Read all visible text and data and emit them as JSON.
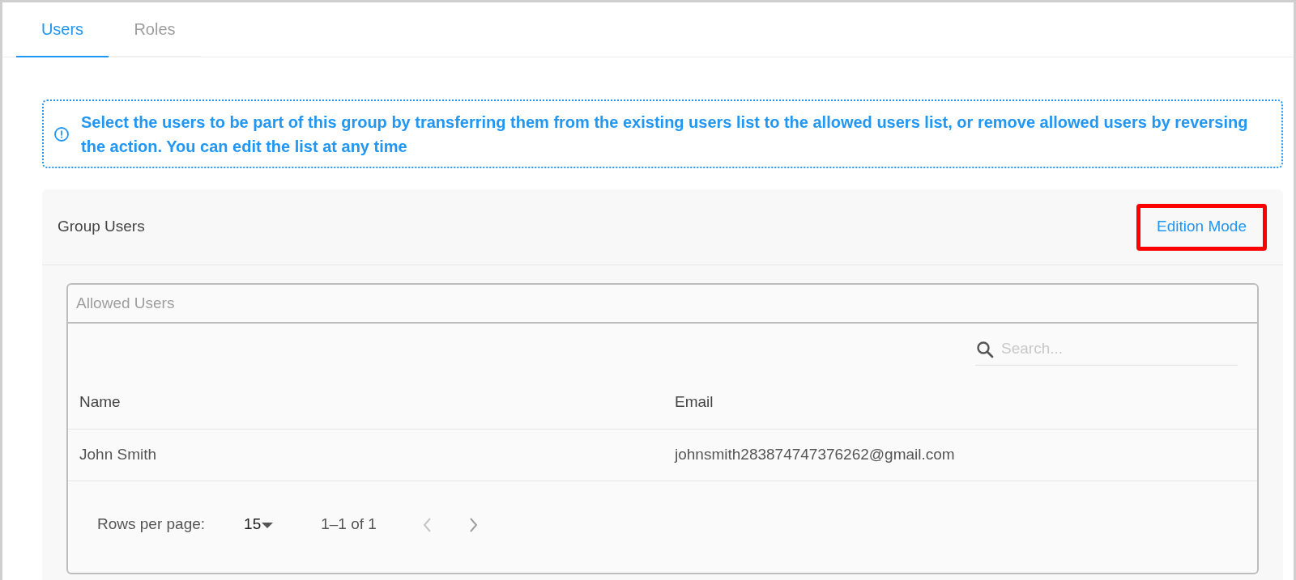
{
  "tabs": [
    {
      "label": "Users",
      "selected": true
    },
    {
      "label": "Roles",
      "selected": false
    }
  ],
  "info_message": "Select the users to be part of this group by transferring them from the existing users list to the allowed users list, or remove allowed users by reversing the action. You can edit the list at any time",
  "group_panel": {
    "title": "Group Users",
    "action": {
      "label": "Edition Mode",
      "highlighted": true
    },
    "table": {
      "title": "Allowed Users",
      "search": {
        "placeholder": "Search..."
      },
      "columns": [
        "Name",
        "Email"
      ],
      "rows": [
        [
          "John Smith",
          "johnsmith283874747376262@gmail.com"
        ]
      ],
      "pagination": {
        "label": "Rows per page:",
        "rows_per_page": "15",
        "range": "1–1 of 1"
      }
    }
  }
}
